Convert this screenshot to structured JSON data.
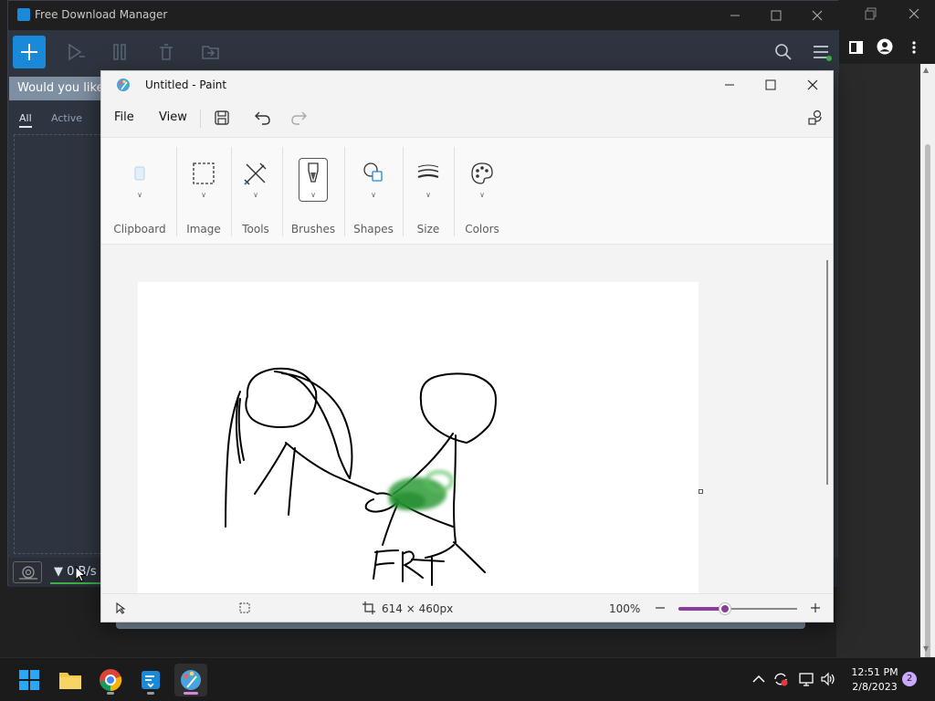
{
  "fdm": {
    "title": "Free Download Manager",
    "notice": "Would you like t",
    "tabs": {
      "all": "All",
      "active": "Active"
    },
    "speed": "▼ 0 B/s"
  },
  "paint": {
    "title": "Untitled - Paint",
    "menu": {
      "file": "File",
      "view": "View"
    },
    "ribbon": {
      "clipboard": "Clipboard",
      "image": "Image",
      "tools": "Tools",
      "brushes": "Brushes",
      "shapes": "Shapes",
      "size": "Size",
      "colors": "Colors"
    },
    "status": {
      "canvas_size": "614 × 460px",
      "zoom": "100%"
    },
    "brush_color": "#2e9b3a"
  },
  "taskbar": {
    "time": "12:51 PM",
    "date": "2/8/2023",
    "notifications": "2"
  }
}
